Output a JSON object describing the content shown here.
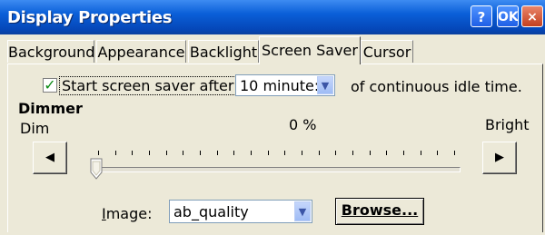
{
  "window": {
    "title": "Display Properties",
    "help_label": "?",
    "ok_label": "OK",
    "close_label": "×"
  },
  "tabs": [
    "Background",
    "Appearance",
    "Backlight",
    "Screen Saver",
    "Cursor"
  ],
  "active_tab": "Screen Saver",
  "screen_saver": {
    "enabled": true,
    "checkbox_label": "Start screen saver after",
    "idle_time_value": "10 minute:",
    "idle_suffix": "of continuous idle time."
  },
  "dimmer": {
    "heading": "Dimmer",
    "dim_label": "Dim",
    "bright_label": "Bright",
    "percent_text": "0 %",
    "level": 0,
    "decrease_glyph": "◀",
    "increase_glyph": "▶",
    "tick_count": 22
  },
  "image": {
    "label": "Image:",
    "value": "ab_quality",
    "browse_label": "Browse..."
  },
  "icons": {
    "dropdown": "chevron-down-icon",
    "check": "check-icon"
  },
  "colors": {
    "titlebar": "#0a5fd8",
    "face": "#ece9d8",
    "check": "#0c8a14"
  }
}
